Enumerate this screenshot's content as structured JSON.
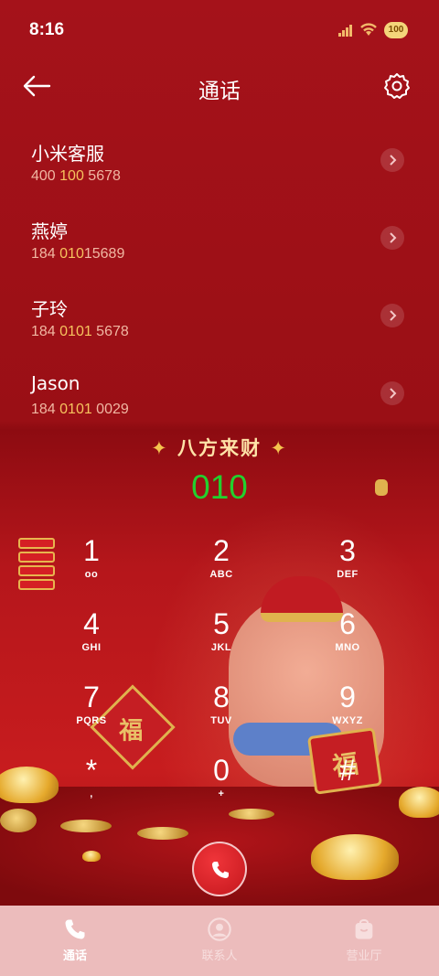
{
  "status_bar": {
    "time": "8:16",
    "battery": "100"
  },
  "header": {
    "title": "通话",
    "back_icon": "arrow-left-icon",
    "settings_icon": "gear-icon"
  },
  "contacts": [
    {
      "name": "小米客服",
      "number_pre": "400 ",
      "number_hl": "100",
      "number_post": " 5678"
    },
    {
      "name": "燕婷",
      "number_pre": "184 ",
      "number_hl": "010",
      "number_post": "15689"
    },
    {
      "name": "子玲",
      "number_pre": "184 ",
      "number_hl": "0101",
      "number_post": " 5678"
    },
    {
      "name": "Jason",
      "number_pre": "184 ",
      "number_hl": "0101",
      "number_post": " 0029"
    }
  ],
  "banner": {
    "left": "✦",
    "text": "八方来财",
    "right": "✦"
  },
  "dialed_number": "010",
  "keypad": [
    {
      "digit": "1",
      "letters": "ᴏᴏ"
    },
    {
      "digit": "2",
      "letters": "ABC"
    },
    {
      "digit": "3",
      "letters": "DEF"
    },
    {
      "digit": "4",
      "letters": "GHI"
    },
    {
      "digit": "5",
      "letters": "JKL"
    },
    {
      "digit": "6",
      "letters": "MNO"
    },
    {
      "digit": "7",
      "letters": "PQRS"
    },
    {
      "digit": "8",
      "letters": "TUV"
    },
    {
      "digit": "9",
      "letters": "WXYZ"
    },
    {
      "digit": "*",
      "letters": ","
    },
    {
      "digit": "0",
      "letters": "+"
    },
    {
      "digit": "#",
      "letters": ""
    }
  ],
  "decor": {
    "fu_char": "福"
  },
  "nav": [
    {
      "label": "通话",
      "icon": "phone-icon",
      "active": true
    },
    {
      "label": "联系人",
      "icon": "person-icon",
      "active": false
    },
    {
      "label": "营业厅",
      "icon": "bag-icon",
      "active": false
    }
  ],
  "colors": {
    "accent_green": "#22d12e",
    "highlight": "#f6c35e",
    "background": "#9c0f12"
  }
}
